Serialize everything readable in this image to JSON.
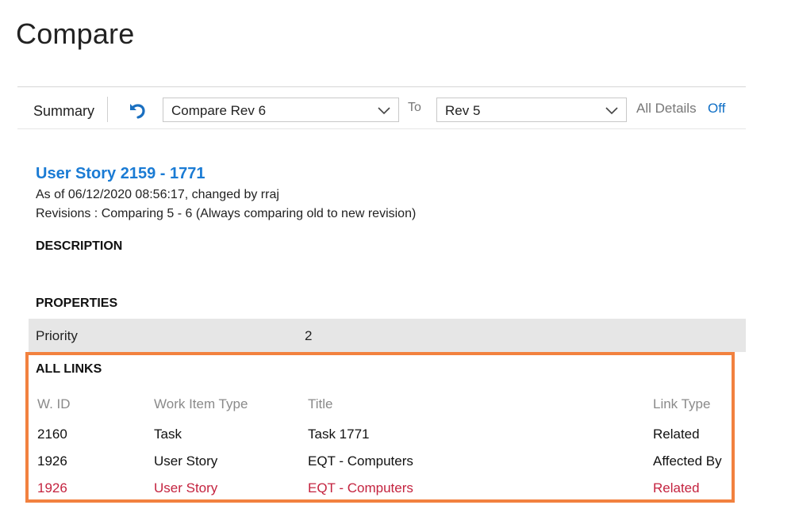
{
  "page": {
    "title": "Compare"
  },
  "toolbar": {
    "summary_label": "Summary",
    "from_select": {
      "value": "Compare Rev 6"
    },
    "to_label": "To",
    "to_select": {
      "value": "Rev 5"
    },
    "all_details_label": "All Details",
    "all_details_toggle": "Off"
  },
  "work_item": {
    "title": "User Story 2159 - 1771",
    "as_of": "As of 06/12/2020 08:56:17, changed by rraj",
    "revisions": "Revisions : Comparing 5 - 6 (Always comparing old to new revision)"
  },
  "sections": {
    "description": "DESCRIPTION",
    "properties": "PROPERTIES",
    "all_links": "ALL LINKS"
  },
  "properties": [
    {
      "name": "Priority",
      "value": "2"
    }
  ],
  "links": {
    "headers": {
      "id": "W. ID",
      "type": "Work Item Type",
      "title": "Title",
      "link_type": "Link Type"
    },
    "rows": [
      {
        "id": "2160",
        "type": "Task",
        "title": "Task 1771",
        "link_type": "Related",
        "status": "unchanged"
      },
      {
        "id": "1926",
        "type": "User Story",
        "title": "EQT - Computers",
        "link_type": "Affected By",
        "status": "unchanged"
      },
      {
        "id": "1926",
        "type": "User Story",
        "title": "EQT - Computers",
        "link_type": "Related",
        "status": "changed"
      }
    ]
  },
  "colors": {
    "accent_blue": "#1a7bd4",
    "link_blue": "#0f6fc6",
    "changed_red": "#c4233f",
    "highlight_orange": "#f2813f",
    "property_row_bg": "#e6e6e6"
  }
}
